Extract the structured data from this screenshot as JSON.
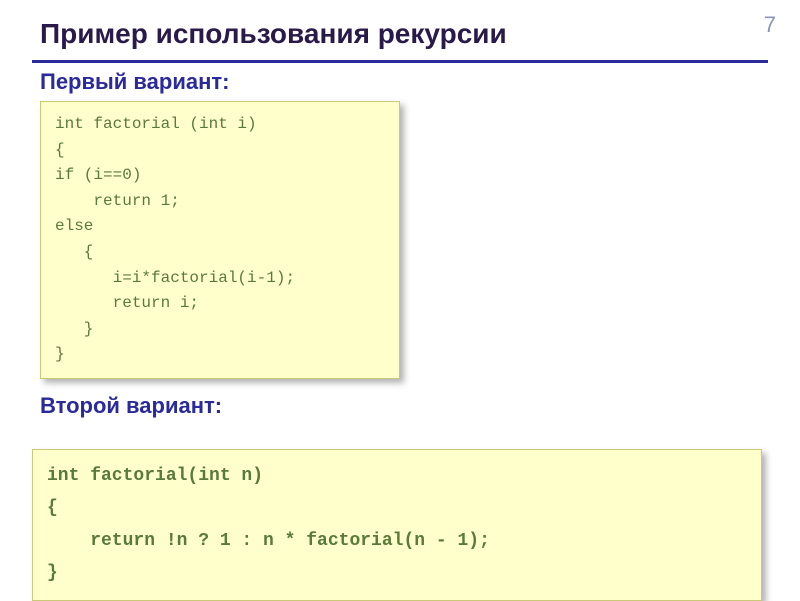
{
  "page_number": "7",
  "title": "Пример использования рекурсии",
  "subtitle1": "Первый вариант:",
  "subtitle2": "Второй вариант:",
  "code1": "int factorial (int i)\n{\nif (i==0)\n    return 1;\nelse\n   {\n      i=i*factorial(i-1);\n      return i;\n   }\n}",
  "code2": "int factorial(int n)\n{\n    return !n ? 1 : n * factorial(n - 1);\n}"
}
